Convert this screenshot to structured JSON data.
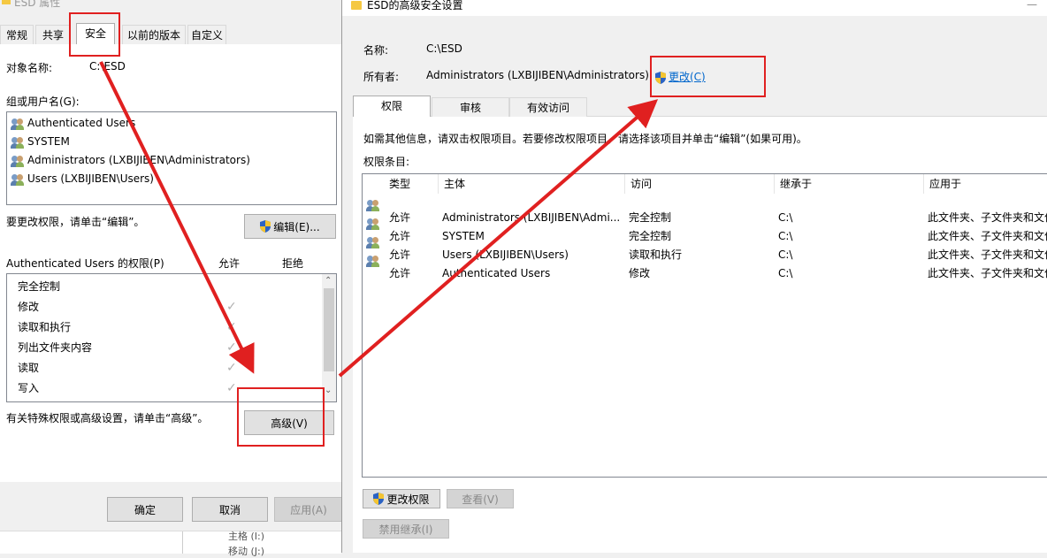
{
  "left": {
    "title": "ESD 属性",
    "tabs": [
      "常规",
      "共享",
      "安全",
      "以前的版本",
      "自定义"
    ],
    "object_label": "对象名称:",
    "object_value": "C:\\ESD",
    "group_label": "组或用户名(G):",
    "users": [
      "Authenticated Users",
      "SYSTEM",
      "Administrators (LXBIJIBEN\\Administrators)",
      "Users (LXBIJIBEN\\Users)"
    ],
    "change_hint": "要更改权限，请单击“编辑”。",
    "edit_button": "编辑(E)...",
    "perm_header": "Authenticated Users 的权限(P)",
    "allow_col": "允许",
    "deny_col": "拒绝",
    "permissions": [
      "完全控制",
      "修改",
      "读取和执行",
      "列出文件夹内容",
      "读取",
      "写入"
    ],
    "check_glyph": "✓",
    "advanced_hint": "有关特殊权限或高级设置，请单击“高级”。",
    "advanced_button": "高级(V)",
    "ok_button": "确定",
    "cancel_button": "取消",
    "apply_button": "应用(A)",
    "bg_items": [
      "主格 (I:)",
      "移动 (J:)"
    ]
  },
  "right": {
    "title": "ESD的高级安全设置",
    "name_label": "名称:",
    "name_value": "C:\\ESD",
    "owner_label": "所有者:",
    "owner_value": "Administrators (LXBIJIBEN\\Administrators)",
    "change_link": "更改(C)",
    "tabs": [
      "权限",
      "审核",
      "有效访问"
    ],
    "info_text": "如需其他信息，请双击权限项目。若要修改权限项目，请选择该项目并单击“编辑”(如果可用)。",
    "entries_label": "权限条目:",
    "columns": [
      "类型",
      "主体",
      "访问",
      "继承于",
      "应用于"
    ],
    "rows": [
      [
        "允许",
        "Administrators (LXBIJIBEN\\Admi...",
        "完全控制",
        "C:\\",
        "此文件夹、子文件夹和文件"
      ],
      [
        "允许",
        "SYSTEM",
        "完全控制",
        "C:\\",
        "此文件夹、子文件夹和文件"
      ],
      [
        "允许",
        "Users (LXBIJIBEN\\Users)",
        "读取和执行",
        "C:\\",
        "此文件夹、子文件夹和文件"
      ],
      [
        "允许",
        "Authenticated Users",
        "修改",
        "C:\\",
        "此文件夹、子文件夹和文件"
      ]
    ],
    "change_perm_button": "更改权限",
    "view_button": "查看(V)",
    "disable_inherit_button": "禁用继承(I)"
  },
  "colors": {
    "annotation": "#e02020",
    "link": "#0066cc"
  }
}
